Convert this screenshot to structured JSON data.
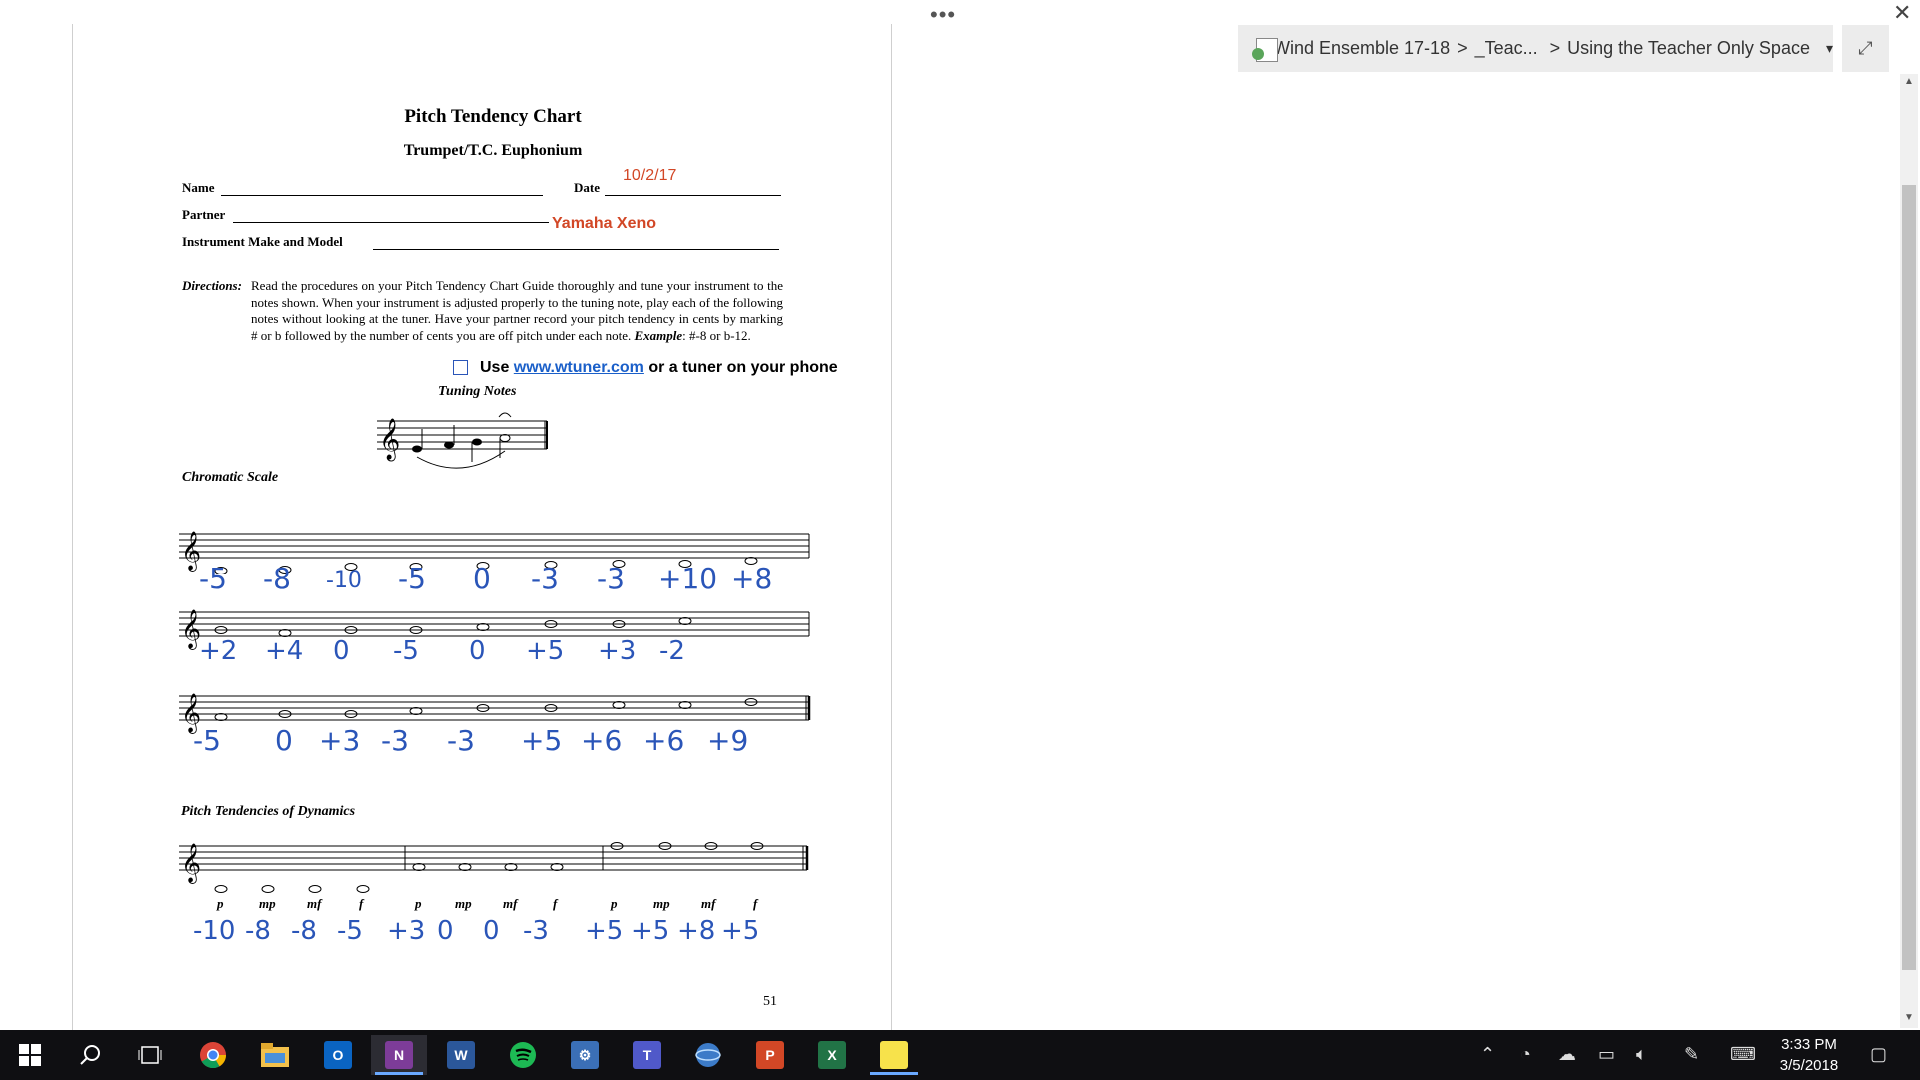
{
  "window": {
    "more_dots": "•••",
    "close_glyph": "✕"
  },
  "breadcrumb": {
    "notebook": "Wind Ensemble 17-18",
    "sep1": ">",
    "section": "_Teac...",
    "sep2": ">",
    "page": "Using the Teacher Only Space",
    "dropdown_glyph": "▾",
    "expand_glyph": "⤢"
  },
  "doc": {
    "title": "Pitch Tendency Chart",
    "subtitle": "Trumpet/T.C. Euphonium",
    "name_label": "Name",
    "date_label": "Date",
    "date_value": "10/2/17",
    "partner_label": "Partner",
    "instrument_label": "Instrument Make and Model",
    "instrument_value": "Yamaha Xeno",
    "directions_label": "Directions:",
    "directions_text": "Read the procedures on your Pitch Tendency Chart Guide thoroughly and tune your instrument to the notes shown.  When your instrument is adjusted properly to the tuning note, play each of the following notes without looking at the tuner.  Have your partner record your pitch tendency in cents by marking # or b followed by the number of cents you are off pitch under each note.",
    "example_label": "Example",
    "example_text": ": #-8 or b-12.",
    "tuner_prefix": "Use ",
    "tuner_link": "www.wtuner.com",
    "tuner_suffix": " or a tuner on your phone",
    "tuning_notes": "Tuning Notes",
    "chromatic_scale": "Chromatic Scale",
    "dynamics_title": "Pitch Tendencies of Dynamics",
    "page_number": "51",
    "row1": [
      "-5",
      "-8",
      "-10",
      "-5",
      "0",
      "-3",
      "-3",
      "+10",
      "+8"
    ],
    "row2": [
      "+2",
      "+4",
      "0",
      "-5",
      "0",
      "+5",
      "+3",
      "-2"
    ],
    "row3": [
      "-5",
      "0",
      "+3",
      "-3",
      "-3",
      "+5",
      "+6",
      "+6",
      "+9"
    ],
    "dynamics_marks": [
      "p",
      "mp",
      "mf",
      "f",
      "p",
      "mp",
      "mf",
      "f",
      "p",
      "mp",
      "mf",
      "f"
    ],
    "dynamics_values": [
      "-10",
      "-8",
      "-8",
      "-5",
      "+3",
      "0",
      "0",
      "-3",
      "+5",
      "+5",
      "+8",
      "+5"
    ]
  },
  "taskbar": {
    "clock_time": "3:33 PM",
    "clock_date": "3/5/2018",
    "apps": [
      "start-icon",
      "search-icon",
      "task-view-icon",
      "chrome-icon",
      "file-explorer-icon",
      "outlook-icon",
      "onenote-icon",
      "word-icon",
      "spotify-icon",
      "app-icon",
      "teams-icon",
      "app2-icon",
      "powerpoint-icon",
      "excel-icon",
      "sticky-notes-icon"
    ]
  },
  "colors": {
    "ink": "#2a55b8",
    "typed_red": "#d24726",
    "taskbar": "#0f0f12"
  }
}
